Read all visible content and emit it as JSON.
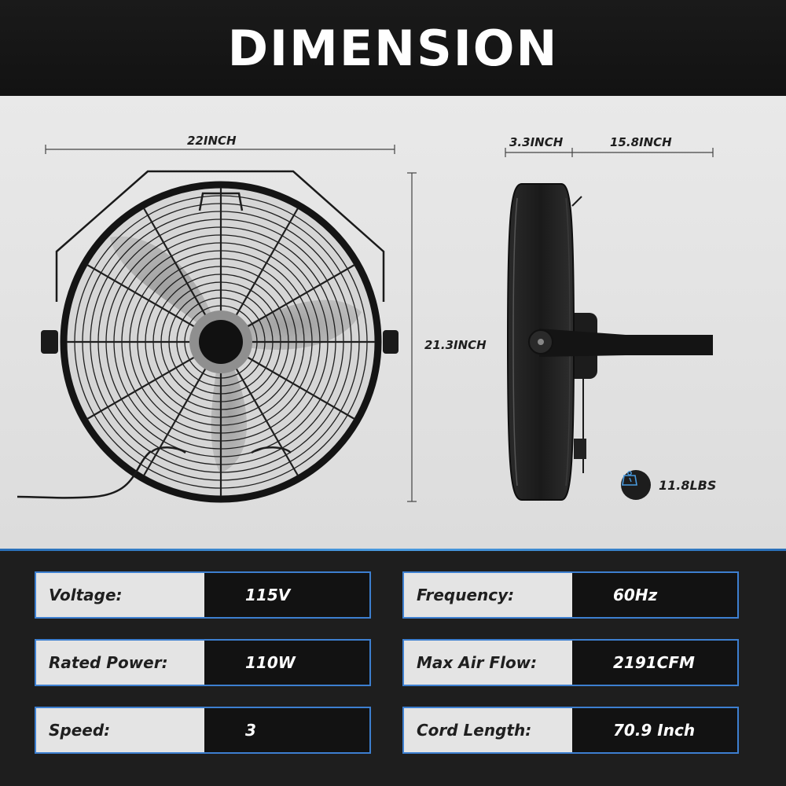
{
  "header": {
    "title": "DIMENSION"
  },
  "dimensions": {
    "width": "22INCH",
    "height": "21.3INCH",
    "depth_front": "3.3INCH",
    "depth_mount": "15.8INCH",
    "weight": "11.8LBS"
  },
  "icons": {
    "weight": "weight-scale-icon"
  },
  "colors": {
    "accent": "#3d7fd0",
    "dark": "#121212",
    "light": "#e4e4e4"
  },
  "specs": [
    {
      "label": "Voltage:",
      "value": "115V"
    },
    {
      "label": "Frequency:",
      "value": "60Hz"
    },
    {
      "label": "Rated Power:",
      "value": "110W"
    },
    {
      "label": "Max Air Flow:",
      "value": "2191CFM"
    },
    {
      "label": "Speed:",
      "value": "3"
    },
    {
      "label": "Cord Length:",
      "value": "70.9 Inch"
    }
  ]
}
